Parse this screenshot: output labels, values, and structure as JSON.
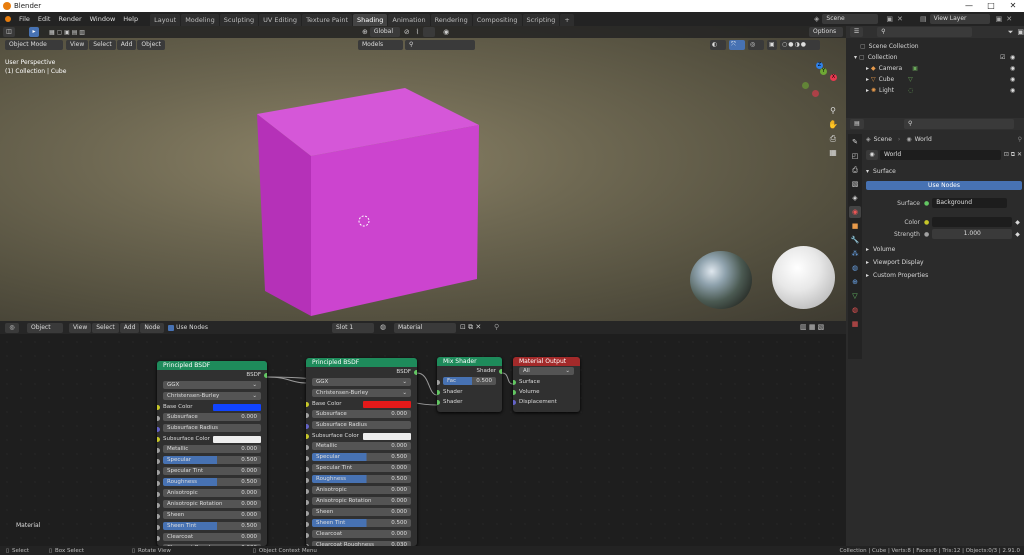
{
  "window": {
    "title": "Blender",
    "controls": [
      "—",
      "□",
      "✕"
    ]
  },
  "menubar": {
    "menus": [
      "File",
      "Edit",
      "Render",
      "Window",
      "Help"
    ],
    "workspaces": [
      "Layout",
      "Modeling",
      "Sculpting",
      "UV Editing",
      "Texture Paint",
      "Shading",
      "Animation",
      "Rendering",
      "Compositing",
      "Scripting"
    ],
    "active_workspace": "Shading",
    "add_tab": "+",
    "scene": "Scene",
    "view_layer": "View Layer"
  },
  "viewport": {
    "mode": "Object Mode",
    "menus": [
      "View",
      "Select",
      "Add",
      "Object"
    ],
    "transform": "Global",
    "models_dropdown": "Models",
    "options": "Options",
    "overlay_line1": "User Perspective",
    "overlay_line2": "(1) Collection | Cube",
    "cube_color": "#c33fc6",
    "gizmo": {
      "x": "X",
      "y": "Y",
      "z": "Z"
    }
  },
  "node_editor": {
    "editor_type": "Object",
    "menus": [
      "View",
      "Select",
      "Add",
      "Node"
    ],
    "use_nodes_label": "Use Nodes",
    "slot": "Slot 1",
    "material": "Material",
    "corner_label": "Material",
    "nodes": {
      "bsdf1": {
        "title": "Principled BSDF",
        "output": "BSDF",
        "distribution": "GGX",
        "sss_method": "Christensen-Burley",
        "base_color_label": "Base Color",
        "base_color": "#1144ff",
        "rows": [
          [
            "Subsurface",
            "0.000"
          ],
          [
            "Subsurface Radius",
            ""
          ],
          [
            "Subsurface Color",
            ""
          ],
          [
            "Metallic",
            "0.000"
          ],
          [
            "Specular",
            "0.500"
          ],
          [
            "Specular Tint",
            "0.000"
          ],
          [
            "Roughness",
            "0.500"
          ],
          [
            "Anisotropic",
            "0.000"
          ],
          [
            "Anisotropic Rotation",
            "0.000"
          ],
          [
            "Sheen",
            "0.000"
          ],
          [
            "Sheen Tint",
            "0.500"
          ],
          [
            "Clearcoat",
            "0.000"
          ],
          [
            "Clearcoat Roughness",
            "0.030"
          ]
        ]
      },
      "bsdf2": {
        "title": "Principled BSDF",
        "output": "BSDF",
        "distribution": "GGX",
        "sss_method": "Christensen-Burley",
        "base_color_label": "Base Color",
        "base_color": "#e31a1a",
        "rows": [
          [
            "Subsurface",
            "0.000"
          ],
          [
            "Subsurface Radius",
            ""
          ],
          [
            "Subsurface Color",
            ""
          ],
          [
            "Metallic",
            "0.000"
          ],
          [
            "Specular",
            "0.500"
          ],
          [
            "Specular Tint",
            "0.000"
          ],
          [
            "Roughness",
            "0.500"
          ],
          [
            "Anisotropic",
            "0.000"
          ],
          [
            "Anisotropic Rotation",
            "0.000"
          ],
          [
            "Sheen",
            "0.000"
          ],
          [
            "Sheen Tint",
            "0.500"
          ],
          [
            "Clearcoat",
            "0.000"
          ],
          [
            "Clearcoat Roughness",
            "0.030"
          ]
        ]
      },
      "mix": {
        "title": "Mix Shader",
        "output": "Shader",
        "fac_label": "Fac",
        "fac": "0.500",
        "in1": "Shader",
        "in2": "Shader"
      },
      "out": {
        "title": "Material Output",
        "target": "All",
        "in1": "Surface",
        "in2": "Volume",
        "in3": "Displacement"
      }
    }
  },
  "outliner": {
    "root": "Scene Collection",
    "collection": "Collection",
    "items": [
      "Camera",
      "Cube",
      "Light"
    ]
  },
  "properties": {
    "breadcrumb_scene": "Scene",
    "breadcrumb_world": "World",
    "world_name": "World",
    "surface_panel": "Surface",
    "use_nodes_btn": "Use Nodes",
    "surface_label": "Surface",
    "surface_value": "Background",
    "color_label": "Color",
    "strength_label": "Strength",
    "strength_value": "1.000",
    "panels": [
      "Volume",
      "Viewport Display",
      "Custom Properties"
    ]
  },
  "statusbar": {
    "select": "Select",
    "box_select": "Box Select",
    "rotate": "Rotate View",
    "context": "Object Context Menu",
    "stats": "Collection | Cube | Verts:8 | Faces:6 | Tris:12 | Objects:0/3 | 2.91.0"
  }
}
